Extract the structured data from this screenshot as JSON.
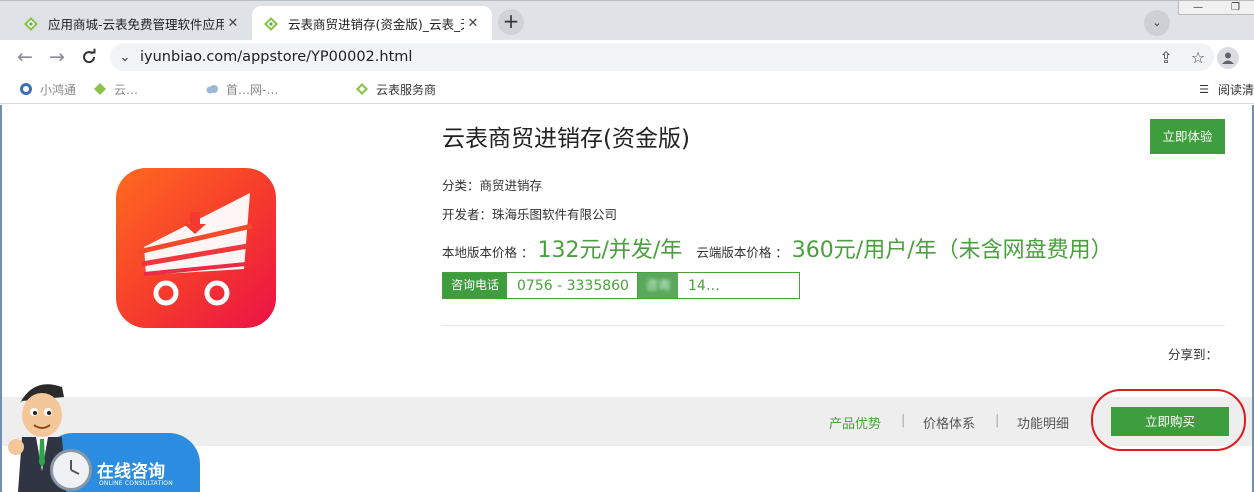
{
  "browser": {
    "tabs": [
      {
        "title": "应用商城-云表免费管理软件应用",
        "active": false
      },
      {
        "title": "云表商贸进销存(资金版)_云表_无",
        "active": true
      }
    ],
    "tab_close_glyph": "✕",
    "new_tab_glyph": "+",
    "tab_search_glyph": "⌄",
    "window_controls": [
      "—",
      "❐"
    ],
    "nav": {
      "back": "←",
      "forward": "→",
      "reload": "C"
    },
    "site_info_glyph": "⌄",
    "url": "iyunbiao.com/appstore/YP00002.html",
    "omnibox_icons": [
      "share-icon",
      "star-icon"
    ],
    "omnibox_glyphs": {
      "share": "⇪",
      "star": "☆"
    },
    "profile_glyph": "👤",
    "bookmarks": [
      {
        "label": "小鸿通",
        "icon": "globe-icon",
        "blurred": true
      },
      {
        "label": "云…",
        "icon": "leaf-icon",
        "blurred": true
      },
      {
        "label": "首…网-…",
        "icon": "cloud-icon",
        "blurred": true
      },
      {
        "label": "云表服务商",
        "icon": "leaf-icon",
        "blurred": false
      }
    ],
    "reading_list": {
      "label": "阅读清",
      "glyph": "☰"
    }
  },
  "product": {
    "title": "云表商贸进销存(资金版)",
    "try_button": "立即体验",
    "category": "分类：商贸进销存",
    "developer": "开发者：珠海乐图软件有限公司",
    "local_price_label": "本地版本价格 ：",
    "local_price": "132元/并发/年",
    "cloud_price_label": "云端版本价格 ：",
    "cloud_price": "360元/用户/年（未含网盘费用）",
    "contacts": [
      {
        "tag": "咨询电话",
        "value": "0756 - 3335860"
      },
      {
        "tag": "咨询",
        "value": "14…"
      }
    ],
    "share_label": "分享到："
  },
  "bottom_nav": {
    "links": [
      "产品优势",
      "价格体系",
      "功能明细"
    ],
    "separator": "|",
    "buy_button": "立即购买"
  },
  "consult": {
    "title": "在线咨询",
    "subtitle": "ONLINE CONSULTATION"
  },
  "colors": {
    "accent_green": "#3e9e3e",
    "price_green": "#4aa03d",
    "highlight_red": "#e01b1b",
    "icon_orange": "#ff6a1f",
    "icon_red": "#ea1246"
  }
}
